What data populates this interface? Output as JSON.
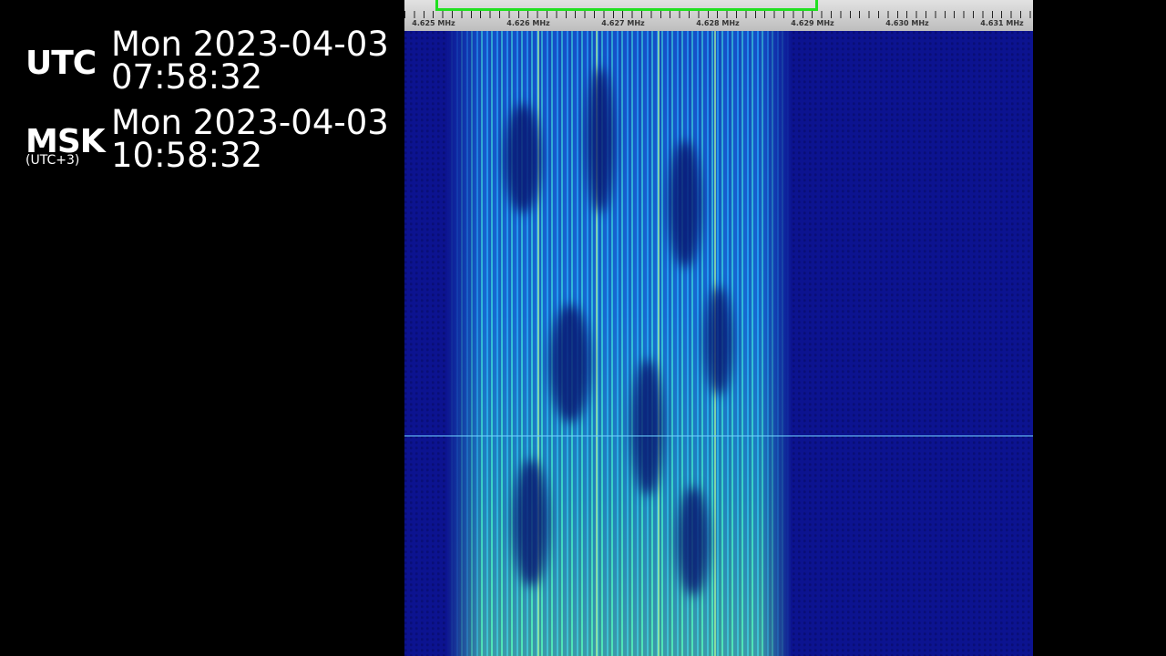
{
  "clock": {
    "utc": {
      "label": "UTC",
      "date": "Mon 2023-04-03",
      "time": "07:58:32"
    },
    "msk": {
      "label": "MSK",
      "offset": "(UTC+3)",
      "date": "Mon 2023-04-03",
      "time": "10:58:32"
    }
  },
  "waterfall": {
    "freq_labels": [
      "4.625 MHz",
      "4.626 MHz",
      "4.627 MHz",
      "4.628 MHz",
      "4.629 MHz",
      "4.630 MHz",
      "4.631 MHz"
    ],
    "colors": {
      "background": "#0c1390",
      "signal_low": "#1a5fd0",
      "signal_high": "#5ee69a",
      "passband": "#20e020",
      "ruler": "#cfcfcf"
    }
  }
}
